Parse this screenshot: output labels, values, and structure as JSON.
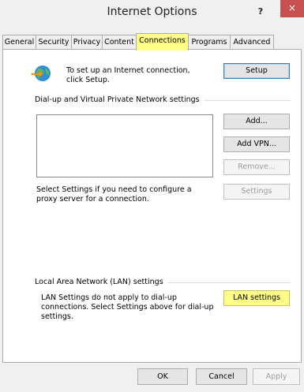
{
  "window": {
    "title": "Internet Options",
    "help_label": "?",
    "close_label": "×"
  },
  "tabs": [
    {
      "label": "General"
    },
    {
      "label": "Security"
    },
    {
      "label": "Privacy"
    },
    {
      "label": "Content"
    },
    {
      "label": "Connections",
      "active": true
    },
    {
      "label": "Programs"
    },
    {
      "label": "Advanced"
    }
  ],
  "setup": {
    "text": "To set up an Internet connection, click Setup.",
    "button": "Setup"
  },
  "dialup": {
    "group_label": "Dial-up and Virtual Private Network settings",
    "add_button": "Add...",
    "add_vpn_button": "Add VPN...",
    "remove_button": "Remove...",
    "settings_text": "Select Settings if you need to configure a proxy server for a connection.",
    "settings_button": "Settings"
  },
  "lan": {
    "group_label": "Local Area Network (LAN) settings",
    "text": "LAN Settings do not apply to dial-up connections. Select Settings above for dial-up settings.",
    "button": "LAN settings"
  },
  "footer": {
    "ok": "OK",
    "cancel": "Cancel",
    "apply": "Apply"
  },
  "colors": {
    "highlight": "#ffff88",
    "close": "#c75050"
  }
}
